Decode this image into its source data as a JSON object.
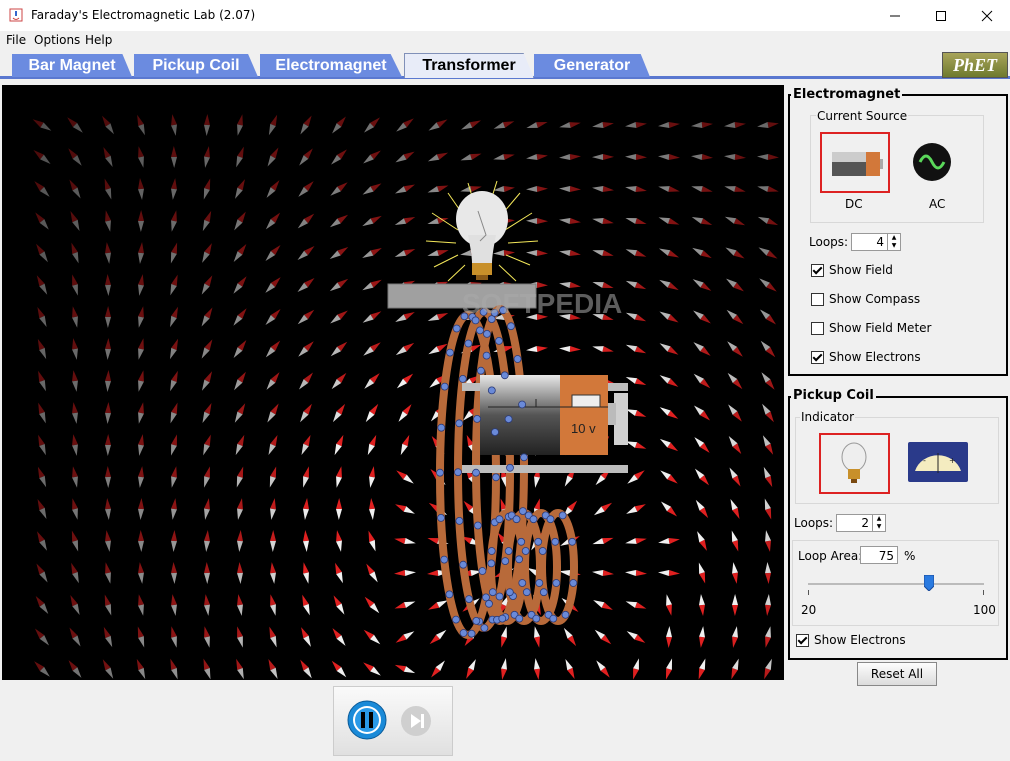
{
  "window": {
    "title": "Faraday's Electromagnetic Lab (2.07)"
  },
  "menu": [
    "File",
    "Options",
    "Help"
  ],
  "tabs": [
    {
      "label": "Bar Magnet"
    },
    {
      "label": "Pickup Coil"
    },
    {
      "label": "Electromagnet"
    },
    {
      "label": "Transformer",
      "active": true
    },
    {
      "label": "Generator"
    }
  ],
  "logo": "PhET",
  "watermark": "SOFTPEDIA",
  "scene": {
    "battery_label": "10 v"
  },
  "electromagnet": {
    "title": "Electromagnet",
    "current_source_label": "Current Source",
    "dc_label": "DC",
    "ac_label": "AC",
    "selected_source": "DC",
    "loops_label": "Loops:",
    "loops_value": "4",
    "show_field": {
      "label": "Show Field",
      "checked": true
    },
    "show_compass": {
      "label": "Show Compass",
      "checked": false
    },
    "show_field_meter": {
      "label": "Show Field Meter",
      "checked": false
    },
    "show_electrons": {
      "label": "Show Electrons",
      "checked": true
    }
  },
  "pickup_coil": {
    "title": "Pickup Coil",
    "indicator_label": "Indicator",
    "selected_indicator": "lightbulb",
    "loops_label": "Loops:",
    "loops_value": "2",
    "loop_area_label": "Loop Area:",
    "loop_area_value": "75",
    "loop_area_unit": "%",
    "slider_min": "20",
    "slider_max": "100",
    "slider_fraction": 0.6875,
    "show_electrons": {
      "label": "Show Electrons",
      "checked": true
    }
  },
  "reset_label": "Reset All",
  "colors": {
    "tab": "#6b8be0",
    "selection": "#dd2222",
    "coil": "#b86a3a"
  }
}
